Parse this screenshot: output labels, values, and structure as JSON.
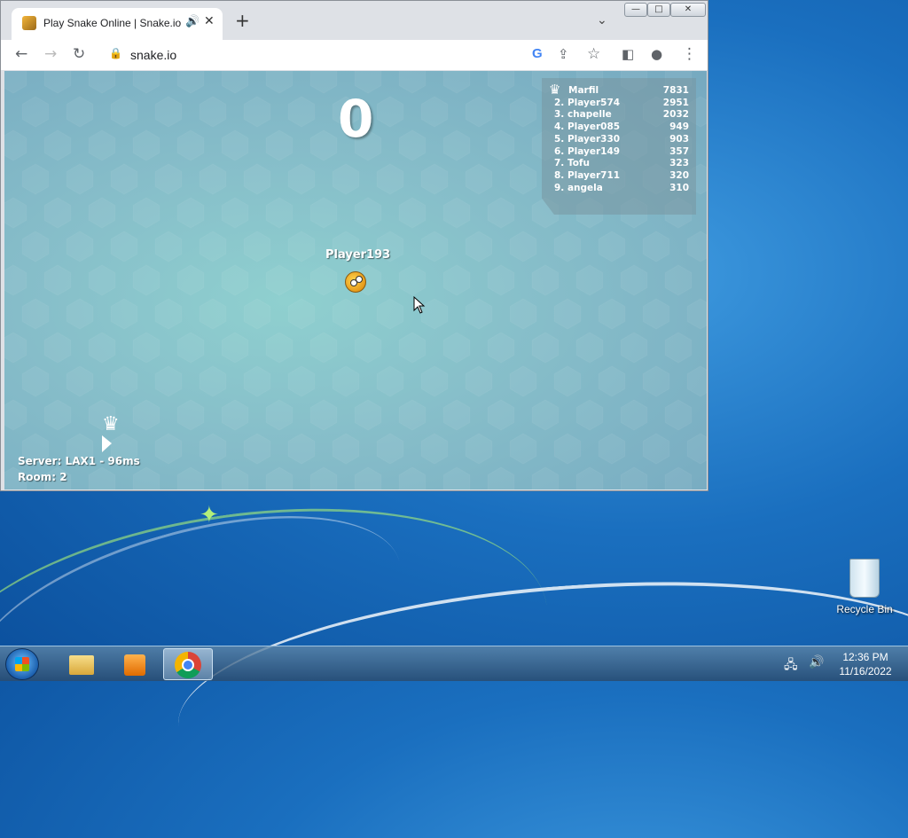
{
  "browser": {
    "tab_title": "Play Snake Online | Snake.io",
    "tab_audio_icon": "speaker-icon",
    "tab_close": "✕",
    "new_tab": "+",
    "url": "snake.io",
    "window_controls": {
      "minimize": "—",
      "maximize": "□",
      "close": "✕"
    }
  },
  "game": {
    "score": "0",
    "player_name": "Player193",
    "server": "Server: LAX1 - 96ms",
    "room": "Room: 2",
    "leaderboard": [
      {
        "name": "Marfil",
        "score": "7831"
      },
      {
        "name": "2. Player574",
        "score": "2951"
      },
      {
        "name": "3. chapelle",
        "score": "2032"
      },
      {
        "name": "4. Player085",
        "score": "949"
      },
      {
        "name": "5. Player330",
        "score": "903"
      },
      {
        "name": "6. Player149",
        "score": "357"
      },
      {
        "name": "7. Tofu",
        "score": "323"
      },
      {
        "name": "8. Player711",
        "score": "320"
      },
      {
        "name": "9. angela",
        "score": "310"
      }
    ]
  },
  "desktop": {
    "recycle_bin_label": "Recycle Bin"
  },
  "taskbar": {
    "time": "12:36 PM",
    "date": "11/16/2022"
  }
}
